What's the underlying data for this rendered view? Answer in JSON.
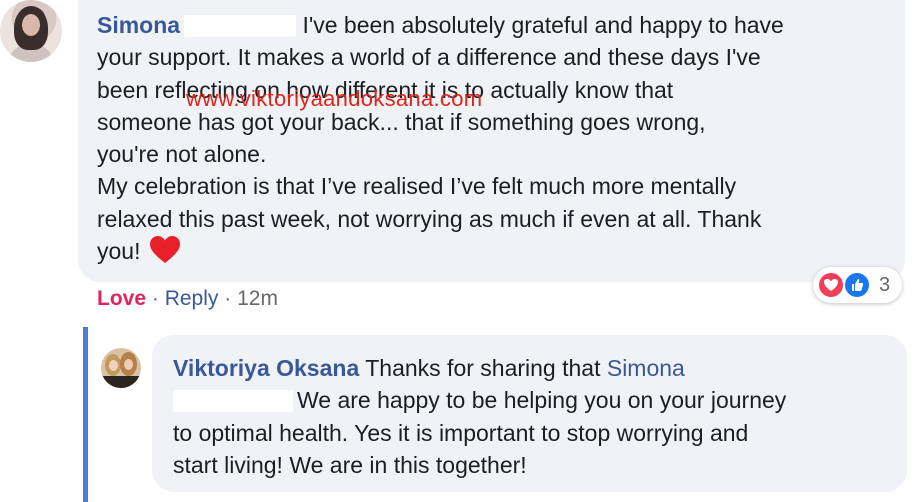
{
  "comment": {
    "author": "Simona",
    "line1": "I've been absolutely grateful and happy to have",
    "line2": "your support. It makes a world of a difference and these days I've",
    "line3": "been reflecting on how different it is to actually know that",
    "line4": "someone has got your back... that if something goes wrong,",
    "line5": "you're not alone.",
    "line6": "My celebration is that I’ve realised I’ve felt much more mentally",
    "line7": "relaxed this past week, not worrying as much if even at all. Thank",
    "line8": "you!"
  },
  "watermark": "www.viktoriyaandoksana.com",
  "actions": {
    "love": "Love",
    "sep": "·",
    "reply": "Reply",
    "time": "12m"
  },
  "reactions": {
    "count": "3",
    "icons": [
      "heart-icon",
      "like-icon"
    ]
  },
  "reply": {
    "author": "Viktoriya Oksana",
    "intro": "Thanks for sharing that",
    "mention": "Simona",
    "line2": "We are happy to be helping you on your journey",
    "line3": "to optimal health. Yes it is important to stop worrying and",
    "line4": "start living! We are in this together!"
  },
  "colors": {
    "link": "#385898",
    "love": "#e0245e",
    "bubble": "#f0f2f5",
    "thread": "#4a7bd3",
    "watermark": "#e0241b"
  }
}
